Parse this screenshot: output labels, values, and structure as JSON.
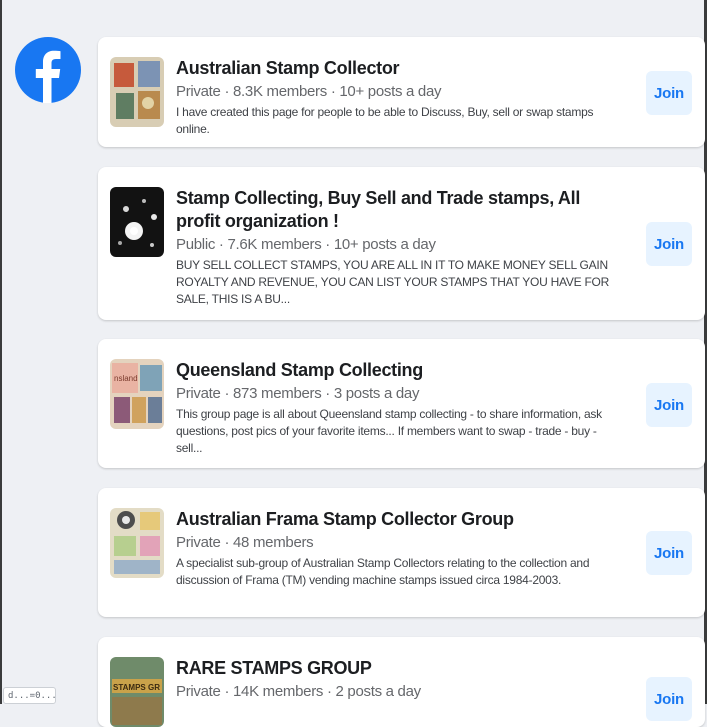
{
  "app": {
    "logo_icon": "facebook-logo-icon",
    "brand_color": "#1877f2"
  },
  "groups": [
    {
      "name": "Australian Stamp Collector",
      "meta": "Private · 8.3K members · 10+ posts a day",
      "description": "I have created this page for people to be able to Discuss, Buy, sell or swap stamps online.",
      "join_label": "Join"
    },
    {
      "name": "Stamp Collecting, Buy Sell and Trade stamps, All profit organization !",
      "meta": "Public · 7.6K members · 10+ posts a day",
      "description": "BUY SELL COLLECT STAMPS, YOU ARE ALL IN IT TO MAKE MONEY SELL GAIN ROYALTY AND REVENUE, YOU CAN LIST YOUR STAMPS THAT YOU HAVE FOR SALE, THIS IS A BU...",
      "join_label": "Join"
    },
    {
      "name": "Queensland Stamp Collecting",
      "meta": "Private · 873 members · 3 posts a day",
      "description": "This group page is all about Queensland stamp collecting - to share information, ask questions, post pics of your favorite items... If members want to swap - trade - buy - sell...",
      "join_label": "Join"
    },
    {
      "name": "Australian Frama Stamp Collector Group",
      "meta": "Private · 48 members",
      "description": "A specialist sub-group of Australian Stamp Collectors relating to the collection and discussion of Frama (TM) vending machine stamps issued circa 1984-2003.",
      "join_label": "Join"
    },
    {
      "name": "RARE STAMPS GROUP",
      "meta": "Private · 14K members · 2 posts a day",
      "description": "",
      "join_label": "Join"
    }
  ],
  "footer_chip": {
    "text": "d...=0..."
  }
}
